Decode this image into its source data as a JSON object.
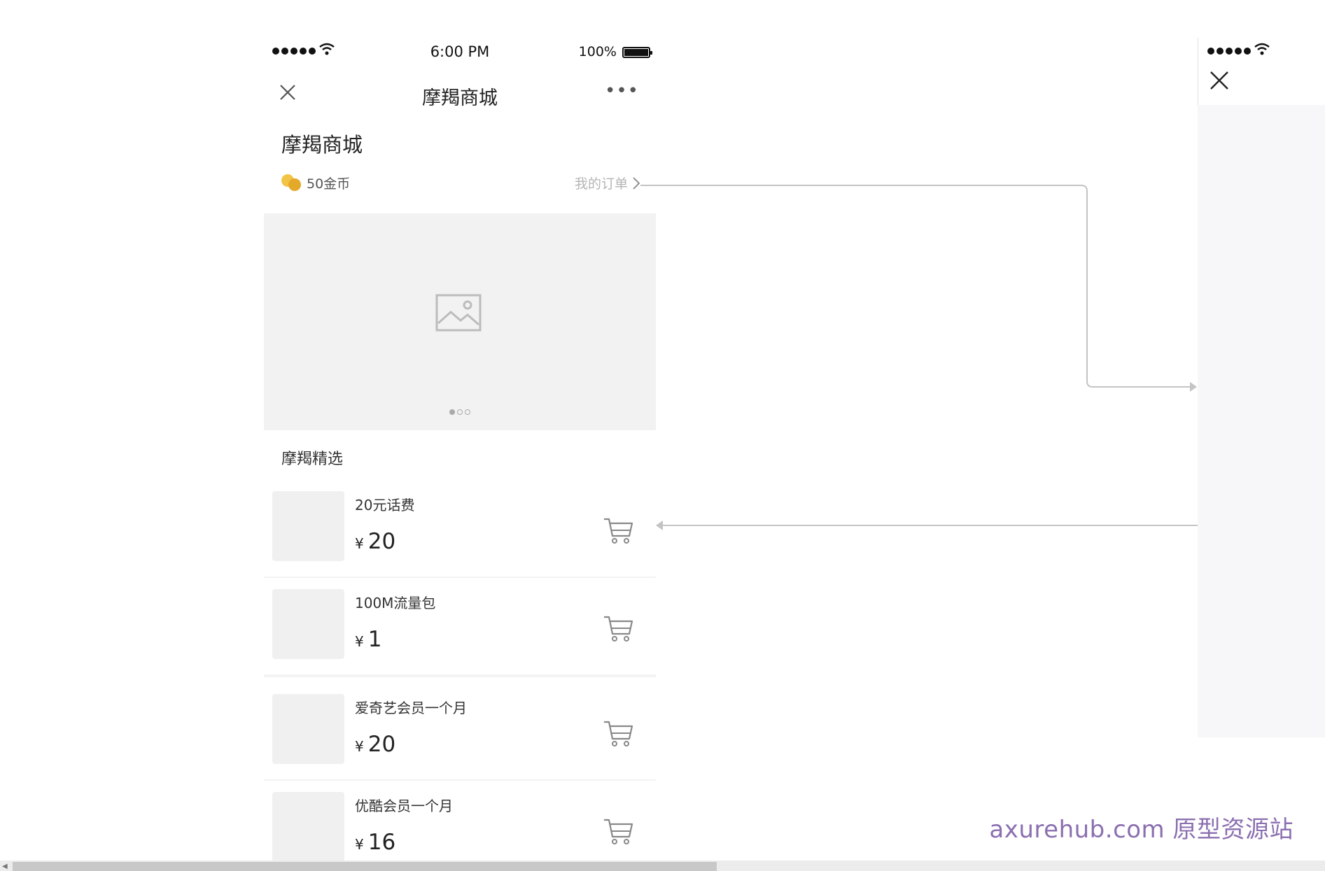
{
  "phone": {
    "status_bar": {
      "time": "6:00 PM",
      "battery": "100%"
    },
    "nav": {
      "title": "摩羯商城"
    },
    "header": {
      "title": "摩羯商城",
      "coins": "50金币",
      "orders_link": "我的订单"
    },
    "banner": {
      "slide_count": 3,
      "active_slide": 1
    },
    "section_title": "摩羯精选",
    "products": [
      {
        "name": "20元话费",
        "currency": "¥",
        "price": "20"
      },
      {
        "name": "100M流量包",
        "currency": "¥",
        "price": "1"
      },
      {
        "name": "爱奇艺会员一个月",
        "currency": "¥",
        "price": "20"
      },
      {
        "name": "优酷会员一个月",
        "currency": "¥",
        "price": "16"
      }
    ]
  },
  "watermark": "axurehub.com 原型资源站",
  "colors": {
    "coin": "#f2c446",
    "watermark": "#8b6fb0",
    "banner_bg": "#f2f2f2",
    "thumb_bg": "#f0f0f0"
  }
}
